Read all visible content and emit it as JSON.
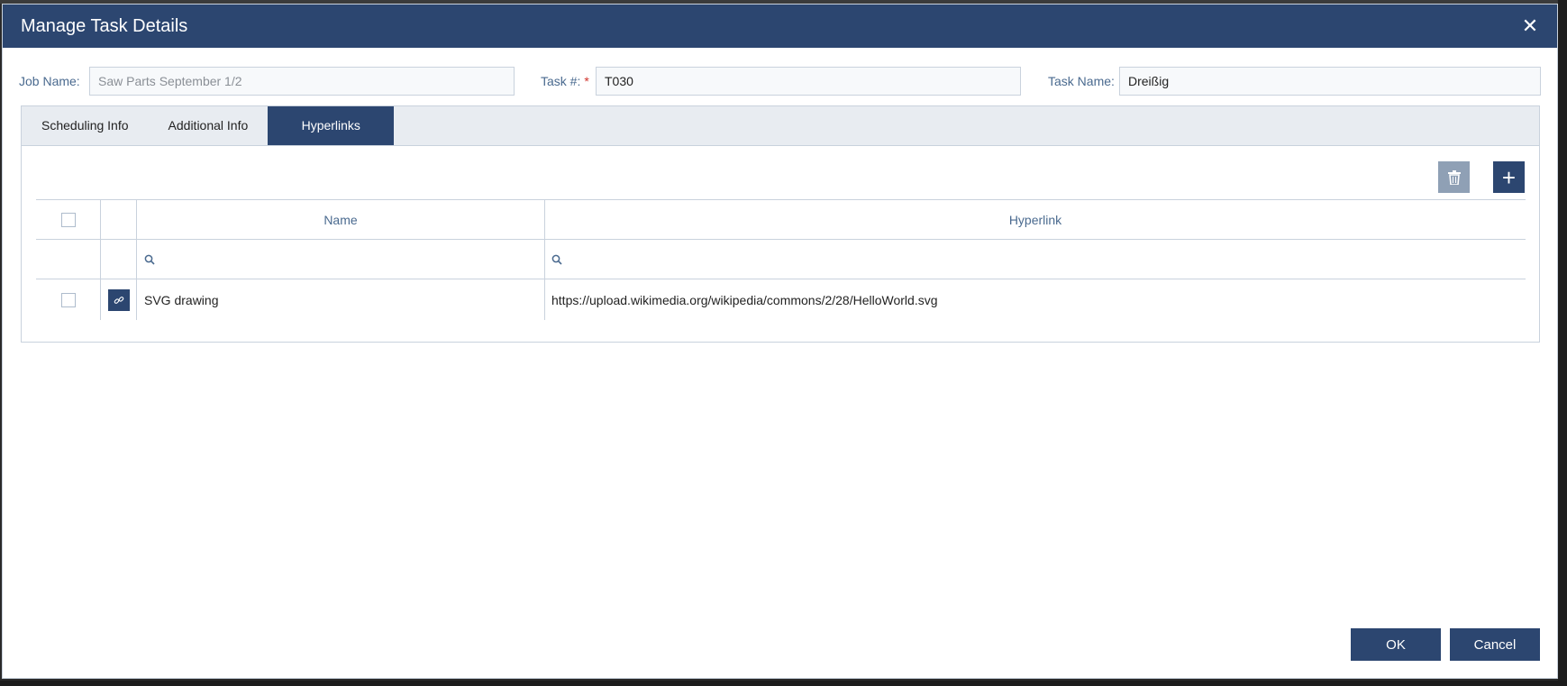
{
  "dialog": {
    "title": "Manage Task Details",
    "close_label": "✕"
  },
  "fields": {
    "job_name_label": "Job Name:",
    "job_name_value": "Saw Parts September 1/2",
    "task_num_label": "Task #:",
    "task_num_required": "*",
    "task_num_value": "T030",
    "task_name_label": "Task Name:",
    "task_name_value": "Dreißig"
  },
  "tabs": [
    {
      "label": "Scheduling Info",
      "active": false
    },
    {
      "label": "Additional Info",
      "active": false
    },
    {
      "label": "Hyperlinks",
      "active": true
    }
  ],
  "toolbar": {
    "delete_icon": "trash-icon",
    "add_label": "+"
  },
  "grid": {
    "columns": {
      "name": "Name",
      "hyperlink": "Hyperlink"
    },
    "rows": [
      {
        "name": "SVG drawing",
        "hyperlink": "https://upload.wikimedia.org/wikipedia/commons/2/28/HelloWorld.svg"
      }
    ]
  },
  "footer": {
    "ok_label": "OK",
    "cancel_label": "Cancel"
  },
  "colors": {
    "primary": "#2c4670",
    "label": "#4a6a8f",
    "border": "#c9d2dd",
    "tab_bar": "#e8ecf1",
    "required": "#d0342c"
  }
}
